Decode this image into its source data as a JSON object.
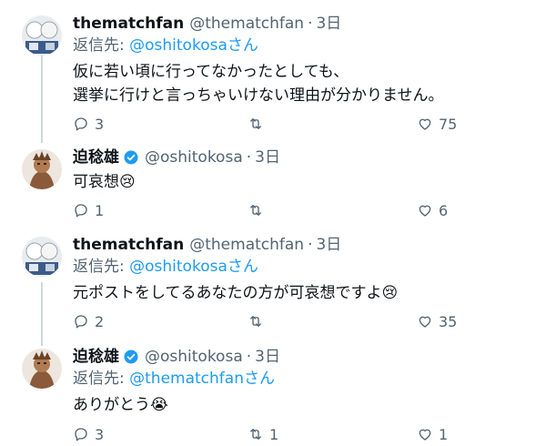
{
  "colors": {
    "handle_blue": "#1d9bf0",
    "secondary_text": "#536471",
    "primary_text": "#0f1419",
    "thread_line": "#cfd9de",
    "verified_badge": "#1d9bf0"
  },
  "icons": {
    "reply": "speech-bubble",
    "retweet": "retweet-arrows",
    "like": "heart",
    "verified": "checkmark-badge"
  },
  "tweets": [
    {
      "display_name": "thematchfan",
      "handle": "@thematchfan",
      "separator": "·",
      "time": "3日",
      "verified": false,
      "reply_prefix": "返信先: ",
      "reply_handle": "@oshitokosa",
      "reply_suffix": "さん",
      "text_lines": [
        "仮に若い頃に行ってなかったとしても、",
        "選挙に行けと言っちゃいけない理由が分かりません。"
      ],
      "reply_count": "3",
      "retweet_count": "",
      "like_count": "75"
    },
    {
      "display_name": "迫稔雄",
      "handle": "@oshitokosa",
      "separator": "·",
      "time": "3日",
      "verified": true,
      "text_lines": [
        "可哀想😢"
      ],
      "reply_count": "1",
      "retweet_count": "",
      "like_count": "6"
    },
    {
      "display_name": "thematchfan",
      "handle": "@thematchfan",
      "separator": "·",
      "time": "3日",
      "verified": false,
      "reply_prefix": "返信先: ",
      "reply_handle": "@oshitokosa",
      "reply_suffix": "さん",
      "text_lines": [
        "元ポストをしてるあなたの方が可哀想ですよ😢"
      ],
      "reply_count": "2",
      "retweet_count": "",
      "like_count": "35"
    },
    {
      "display_name": "迫稔雄",
      "handle": "@oshitokosa",
      "separator": "·",
      "time": "3日",
      "verified": true,
      "reply_prefix": "返信先: ",
      "reply_handle": "@thematchfan",
      "reply_suffix": "さん",
      "text_lines": [
        "ありがとう😭"
      ],
      "reply_count": "3",
      "retweet_count": "1",
      "like_count": "1"
    }
  ]
}
